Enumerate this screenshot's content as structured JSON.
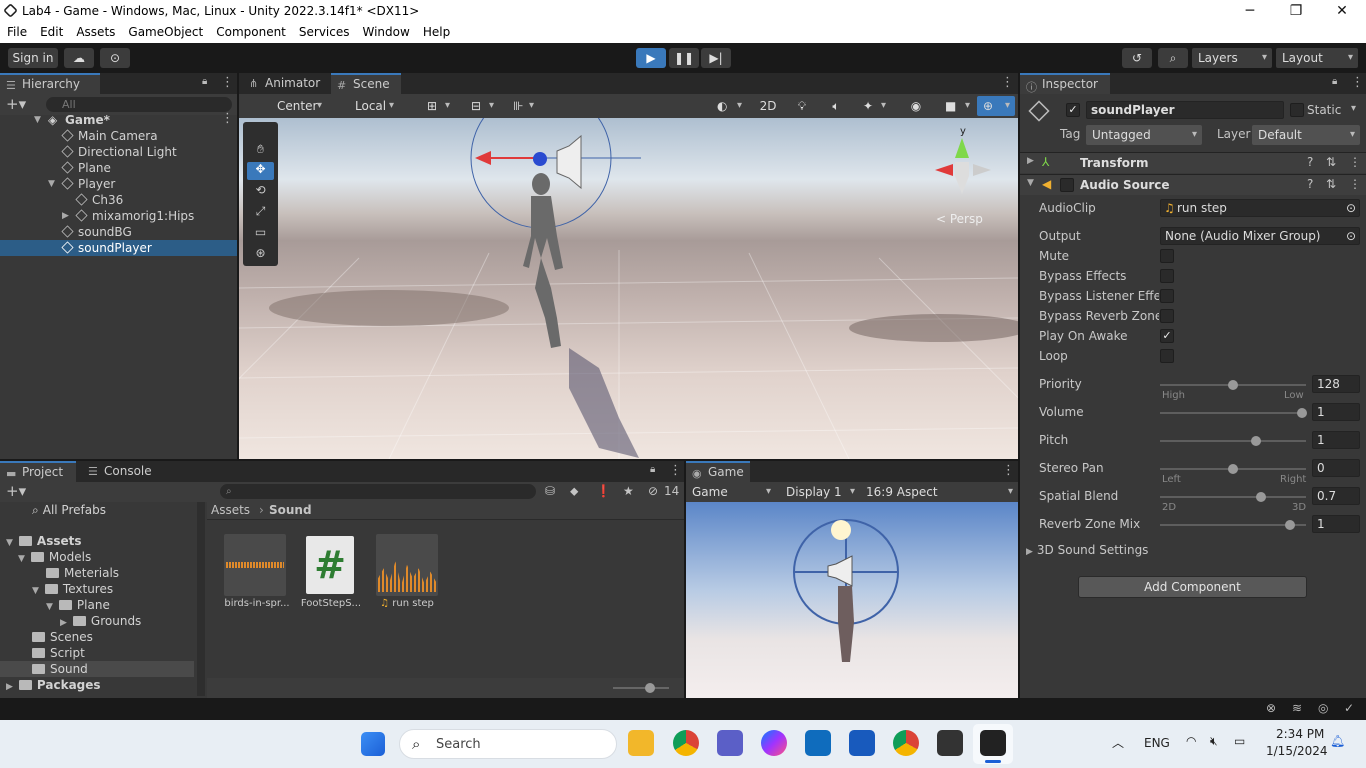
{
  "window": {
    "title": "Lab4 - Game - Windows, Mac, Linux - Unity 2022.3.14f1* <DX11>",
    "min": "─",
    "max": "❐",
    "close": "✕"
  },
  "menu": [
    "File",
    "Edit",
    "Assets",
    "GameObject",
    "Component",
    "Services",
    "Window",
    "Help"
  ],
  "toolbar": {
    "sign_in": "Sign in",
    "layers": "Layers",
    "layout": "Layout"
  },
  "hierarchy": {
    "tab": "Hierarchy",
    "search_placeholder": "All",
    "scene": "Game*",
    "items": [
      {
        "label": "Main Camera"
      },
      {
        "label": "Directional Light"
      },
      {
        "label": "Plane"
      },
      {
        "label": "Player"
      },
      {
        "label": "Ch36"
      },
      {
        "label": "mixamorig1:Hips"
      },
      {
        "label": "soundBG"
      },
      {
        "label": "soundPlayer"
      }
    ]
  },
  "scene": {
    "tabs": [
      "Animator",
      "Scene"
    ],
    "pivot": "Center",
    "space": "Local",
    "mode2d": "2D",
    "persp": "< Persp",
    "gizmo_axis": "y"
  },
  "inspector": {
    "tab": "Inspector",
    "object_name": "soundPlayer",
    "static": "Static",
    "tag_label": "Tag",
    "tag": "Untagged",
    "layer_label": "Layer",
    "layer": "Default",
    "transform": "Transform",
    "audio_source": "Audio Source",
    "fields": {
      "audioclip_label": "AudioClip",
      "audioclip": "run step",
      "output_label": "Output",
      "output": "None (Audio Mixer Group)",
      "mute": "Mute",
      "bypass_effects": "Bypass Effects",
      "bypass_listener": "Bypass Listener Effec",
      "bypass_reverb": "Bypass Reverb Zones",
      "play_on_awake": "Play On Awake",
      "loop": "Loop",
      "priority_label": "Priority",
      "priority": "128",
      "priority_high": "High",
      "priority_low": "Low",
      "volume_label": "Volume",
      "volume": "1",
      "pitch_label": "Pitch",
      "pitch": "1",
      "stereo_label": "Stereo Pan",
      "stereo": "0",
      "stereo_left": "Left",
      "stereo_right": "Right",
      "spatial_label": "Spatial Blend",
      "spatial": "0.7",
      "spatial_2d": "2D",
      "spatial_3d": "3D",
      "reverb_label": "Reverb Zone Mix",
      "reverb": "1",
      "sound3d": "3D Sound Settings"
    },
    "add_component": "Add Component"
  },
  "project": {
    "tabs": [
      "Project",
      "Console"
    ],
    "hidden_count": "14",
    "all_prefabs": "All Prefabs",
    "tree": [
      {
        "label": "Assets"
      },
      {
        "label": "Models"
      },
      {
        "label": "Meterials"
      },
      {
        "label": "Textures"
      },
      {
        "label": "Plane"
      },
      {
        "label": "Grounds"
      },
      {
        "label": "Scenes"
      },
      {
        "label": "Script"
      },
      {
        "label": "Sound"
      },
      {
        "label": "Packages"
      }
    ],
    "breadcrumb": [
      "Assets",
      "Sound"
    ],
    "assets": [
      {
        "label": "birds-in-spr..."
      },
      {
        "label": "FootStepS..."
      },
      {
        "label": "run step"
      }
    ]
  },
  "game": {
    "tab": "Game",
    "view": "Game",
    "display": "Display 1",
    "aspect": "16:9 Aspect"
  },
  "taskbar": {
    "search": "Search",
    "lang": "ENG",
    "time": "2:34 PM",
    "date": "1/15/2024"
  },
  "colors": {
    "accent": "#2c5d87",
    "play": "#3a79bb",
    "orange": "#e08a2a",
    "hash": "#2e7d32"
  }
}
